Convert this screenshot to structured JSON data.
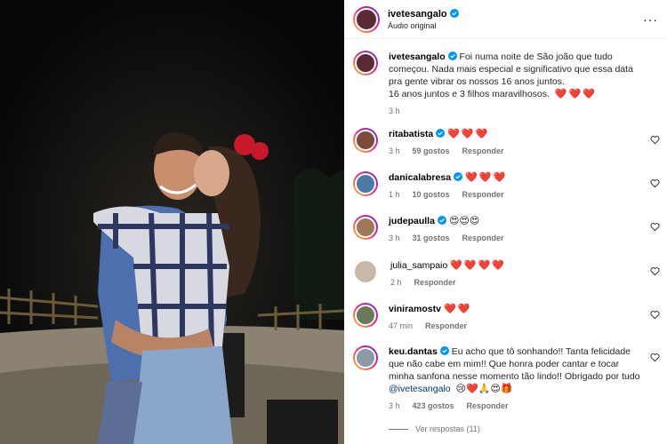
{
  "header": {
    "username": "ivetesangalo",
    "audio": "Áudio original",
    "more": "···"
  },
  "caption": {
    "username": "ivetesangalo",
    "line1": "Foi numa noite de São joão que tudo começou. Nada mais especial e significativo que essa data pra gente vibrar os nossos 16 anos juntos.",
    "line2": "16 anos juntos e 3 filhos maravilhosos.",
    "hearts": "❤️❤️❤️",
    "time": "3 h"
  },
  "comments": [
    {
      "username": "ritabatista",
      "verified": true,
      "text": "❤️❤️❤️",
      "time": "3 h",
      "likes": "59 gostos",
      "reply": "Responder"
    },
    {
      "username": "danicalabresa",
      "verified": true,
      "text": "❤️❤️❤️",
      "time": "1 h",
      "likes": "10 gostos",
      "reply": "Responder"
    },
    {
      "username": "judepaulla",
      "verified": true,
      "text": "😍😍😍",
      "time": "3 h",
      "likes": "31 gostos",
      "reply": "Responder"
    },
    {
      "username": "julia_sampaio",
      "verified": false,
      "text": "❤️❤️❤️❤️",
      "time": "2 h",
      "likes": "",
      "reply": "Responder"
    },
    {
      "username": "viniramostv",
      "verified": false,
      "text": "❤️❤️",
      "time": "47 min",
      "likes": "",
      "reply": "Responder"
    },
    {
      "username": "keu.dantas",
      "verified": true,
      "text": "Eu acho que tô sonhando!! Tanta felicidade que não cabe em mim!! Que honra poder cantar e tocar minha sanfona nesse momento tão lindo!! Obrigado por tudo",
      "mention": "@ivetesangalo",
      "emojis": "😢❤️🙏😍🎁",
      "time": "3 h",
      "likes": "423 gostos",
      "reply": "Responder"
    }
  ],
  "view_replies": "Ver respostas (11)",
  "colors": {
    "verified": "#0095f6",
    "heart": "#ed1c24",
    "meta": "#737373"
  }
}
